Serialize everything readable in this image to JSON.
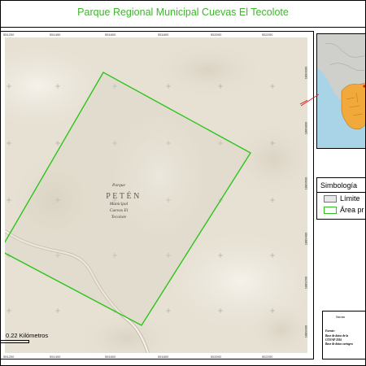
{
  "title": "Parque Regional Municipal Cuevas El Tecolote",
  "map": {
    "top_ticks": [
      "551200",
      "551400",
      "551600",
      "551800",
      "552000",
      "552200"
    ],
    "bottom_ticks": [
      "551200",
      "551400",
      "551600",
      "551800",
      "552000",
      "552200"
    ],
    "right_ticks": [
      "1890000",
      "1889800",
      "1889600",
      "1889400",
      "1889200",
      "1889000"
    ],
    "park_label": [
      "Parque",
      "Municipal",
      "Cuevas El",
      "Tecolote"
    ],
    "region_label": "PETÉN",
    "scale_label": "0.22 Kilómetros",
    "colors": {
      "terrain": "#e7e1d4",
      "boundary": "#2ec41c",
      "road": "#cfc6b8",
      "leader": "#e11a1a"
    }
  },
  "inset": {
    "label": "Guatemala location inset",
    "highlight_color": "#f2a93b"
  },
  "legend": {
    "title": "Simbología",
    "items": [
      {
        "label": "Límite",
        "swatch": "limit"
      },
      {
        "label": "Área pr",
        "swatch": "area"
      }
    ]
  },
  "info": {
    "header": "Sistema",
    "source_label": "Fuente:",
    "lines": [
      "Base de datos de la",
      "CONAP 2016",
      "Base de datos cartogra"
    ]
  }
}
